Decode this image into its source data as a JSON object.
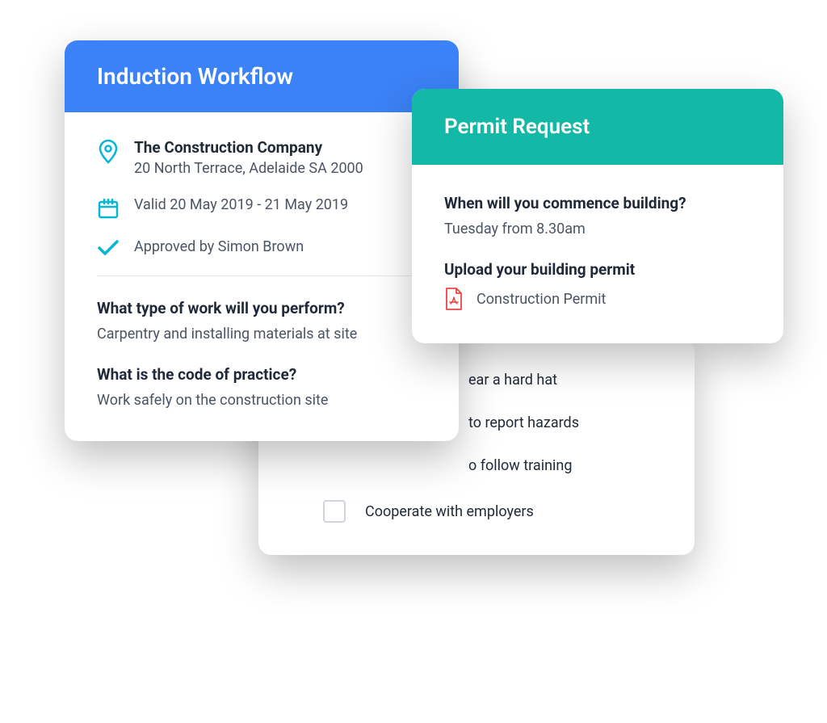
{
  "induction": {
    "title": "Induction Workflow",
    "company": "The Construction Company",
    "address": "20 North Terrace, Adelaide SA 2000",
    "validity": "Valid 20 May 2019 - 21 May 2019",
    "approved_by": "Approved by Simon Brown",
    "q1": "What type of work will you perform?",
    "a1": "Carpentry and installing materials at site",
    "q2": "What is the code of practice?",
    "a2": "Work safely on the construction site"
  },
  "checklist": {
    "items": [
      "ear a hard hat",
      "to report hazards",
      "o follow training",
      "Cooperate with employers"
    ]
  },
  "permit": {
    "title": "Permit Request",
    "q1": "When will you commence building?",
    "a1": "Tuesday from 8.30am",
    "q2": "Upload your building permit",
    "file_name": "Construction Permit"
  },
  "colors": {
    "blue": "#3B82F6",
    "teal": "#14B8A6",
    "cyan": "#06B6D4",
    "red": "#EF4444"
  }
}
